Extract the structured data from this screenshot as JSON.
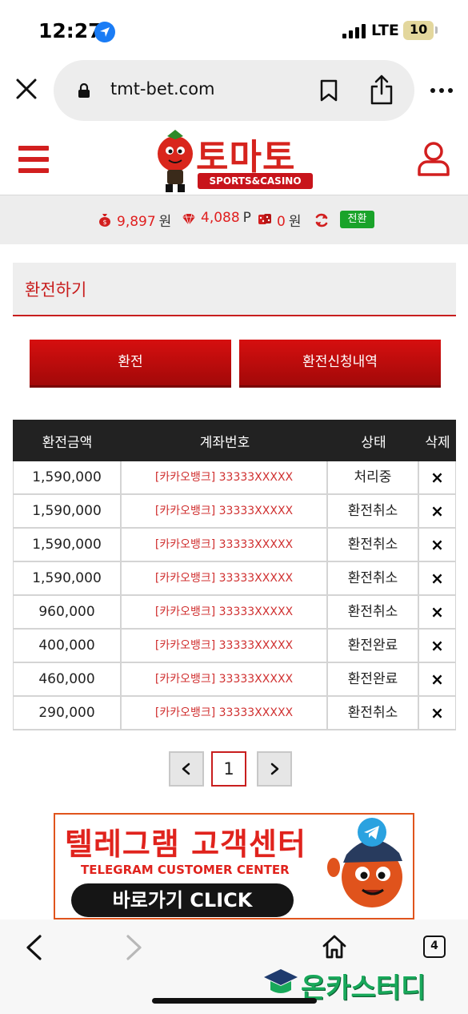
{
  "status_bar": {
    "time": "12:27",
    "network": "LTE",
    "battery": "10"
  },
  "browser": {
    "url": "tmt-bet.com",
    "tab_count": "4"
  },
  "site": {
    "logo_title": "토마토",
    "logo_subtitle": "SPORTS&CASINO"
  },
  "balance": {
    "money": "9,897",
    "money_unit": "원",
    "points": "4,088",
    "points_unit": "P",
    "casino": "0",
    "casino_unit": "원",
    "convert_label": "전환"
  },
  "page": {
    "title": "환전하기",
    "buttons": {
      "exchange": "환전",
      "history": "환전신청내역"
    }
  },
  "table": {
    "headers": {
      "amount": "환전금액",
      "account": "계좌번호",
      "status": "상태",
      "delete": "삭제"
    },
    "rows": [
      {
        "amount": "1,590,000",
        "account": "[카카오뱅크] 33333XXXXX",
        "status": "처리중",
        "delete": "×"
      },
      {
        "amount": "1,590,000",
        "account": "[카카오뱅크] 33333XXXXX",
        "status": "환전취소",
        "delete": "×"
      },
      {
        "amount": "1,590,000",
        "account": "[카카오뱅크] 33333XXXXX",
        "status": "환전취소",
        "delete": "×"
      },
      {
        "amount": "1,590,000",
        "account": "[카카오뱅크] 33333XXXXX",
        "status": "환전취소",
        "delete": "×"
      },
      {
        "amount": "960,000",
        "account": "[카카오뱅크] 33333XXXXX",
        "status": "환전취소",
        "delete": "×"
      },
      {
        "amount": "400,000",
        "account": "[카카오뱅크] 33333XXXXX",
        "status": "환전완료",
        "delete": "×"
      },
      {
        "amount": "460,000",
        "account": "[카카오뱅크] 33333XXXXX",
        "status": "환전완료",
        "delete": "×"
      },
      {
        "amount": "290,000",
        "account": "[카카오뱅크] 33333XXXXX",
        "status": "환전취소",
        "delete": "×"
      }
    ]
  },
  "pagination": {
    "current": "1"
  },
  "banner": {
    "title": "텔레그램 고객센터",
    "subtitle": "TELEGRAM CUSTOMER CENTER",
    "button": "바로가기 CLICK"
  },
  "watermark": "온카스터디",
  "colors": {
    "accent": "#c81e1e",
    "convert_badge": "#1aa32a",
    "table_header": "#222222"
  },
  "icons": [
    "location-icon",
    "signal-icon",
    "close-icon",
    "lock-icon",
    "bookmark-icon",
    "share-icon",
    "more-icon",
    "hamburger-icon",
    "user-icon",
    "money-bag-icon",
    "gem-icon",
    "dice-icon",
    "refresh-icon",
    "prev-icon",
    "next-icon",
    "back-icon",
    "forward-icon",
    "home-icon",
    "tabs-icon"
  ]
}
